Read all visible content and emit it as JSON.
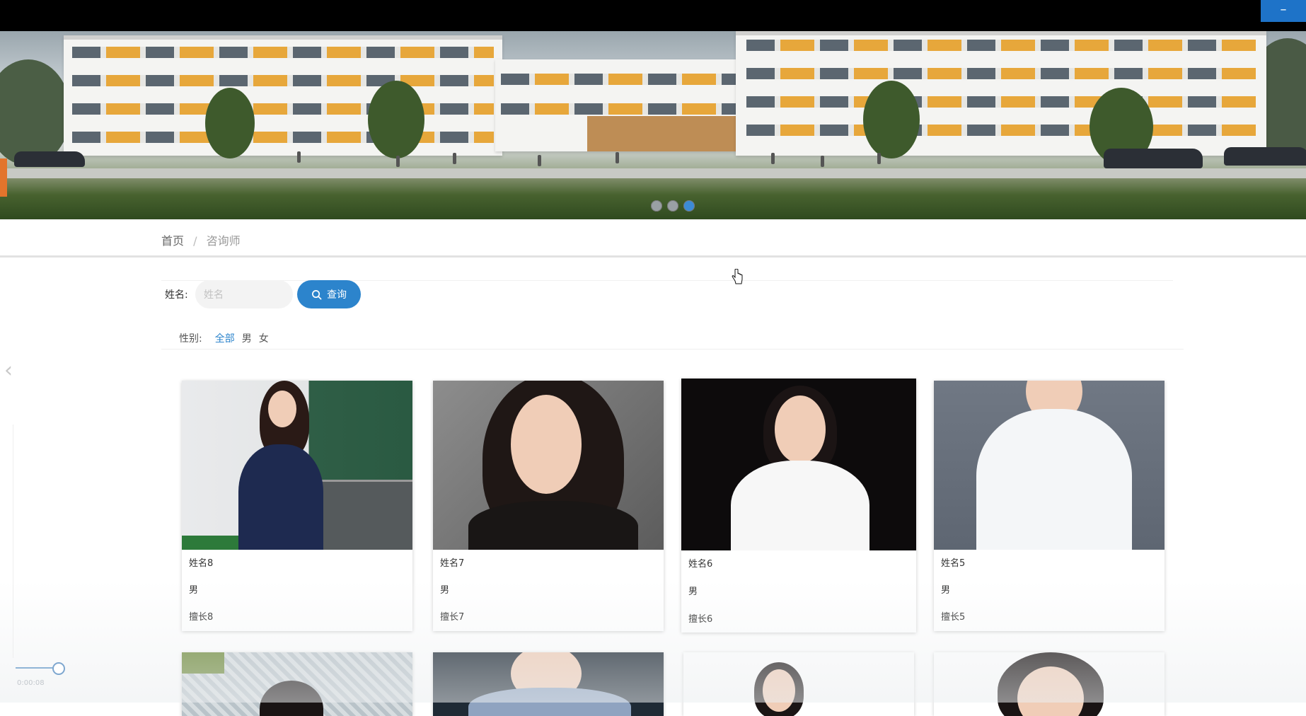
{
  "window": {
    "minimize_label": "–"
  },
  "banner": {
    "slides": 3,
    "active_slide": 3
  },
  "breadcrumb": {
    "home": "首页",
    "separator": "/",
    "current": "咨询师"
  },
  "search": {
    "label": "姓名:",
    "placeholder": "姓名",
    "value": "",
    "button_label": "查询",
    "button_icon": "search-icon"
  },
  "filter": {
    "label": "性别:",
    "options": [
      "全部",
      "男",
      "女"
    ],
    "selected": "全部"
  },
  "counselors": [
    {
      "name": "姓名8",
      "gender": "男",
      "specialty": "擅长8"
    },
    {
      "name": "姓名7",
      "gender": "男",
      "specialty": "擅长7"
    },
    {
      "name": "姓名6",
      "gender": "男",
      "specialty": "擅长6"
    },
    {
      "name": "姓名5",
      "gender": "男",
      "specialty": "擅长5"
    }
  ],
  "player": {
    "time": "0:00:08",
    "progress": 0.8
  },
  "colors": {
    "accent": "#2c84cc",
    "topbar": "#000000",
    "win_button": "#1e73c8"
  }
}
